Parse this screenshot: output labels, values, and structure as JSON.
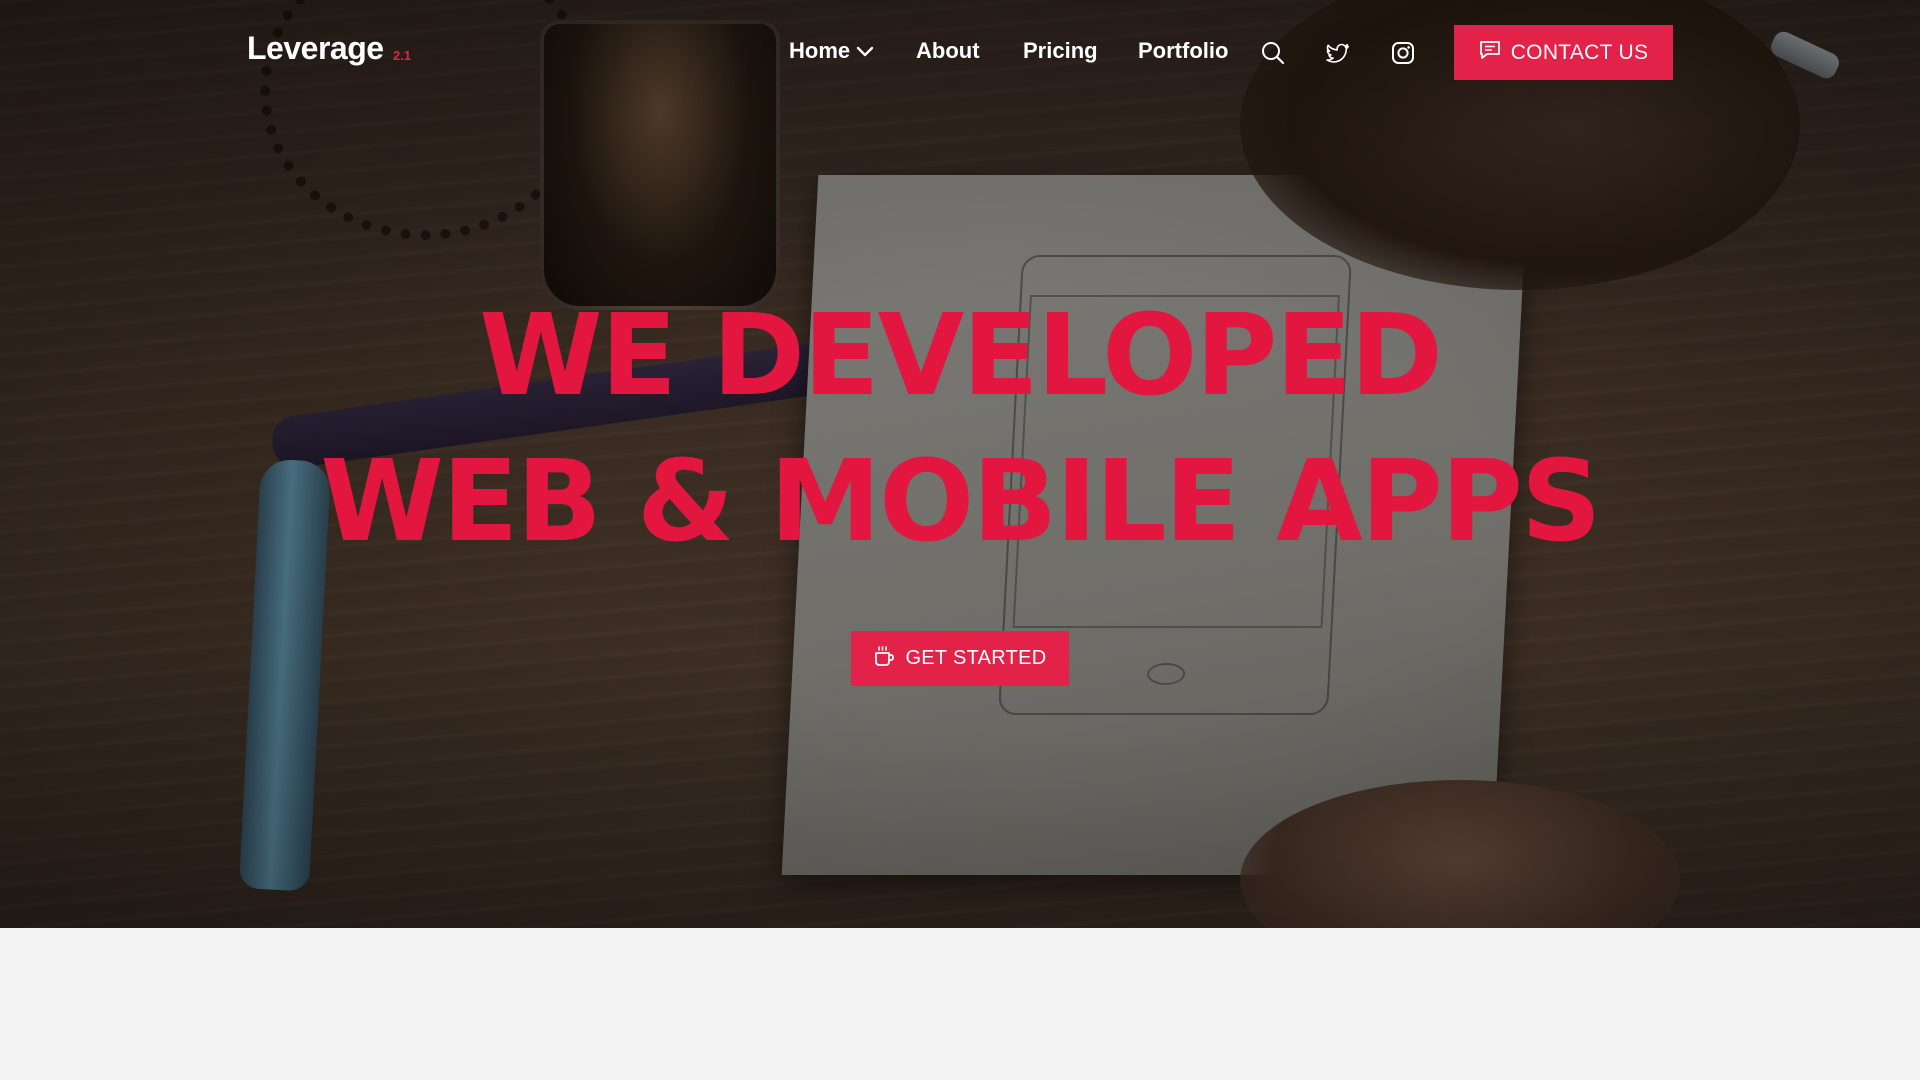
{
  "brand": {
    "name": "Leverage",
    "version": "2.1",
    "accent_color": "#e3224a",
    "headline_color": "#e3163f"
  },
  "nav": {
    "home": "Home",
    "about": "About",
    "pricing": "Pricing",
    "portfolio": "Portfolio",
    "icons": [
      "chevron-down-icon",
      "search-icon",
      "twitter-icon",
      "instagram-icon"
    ]
  },
  "header": {
    "contact_label": "CONTACT US"
  },
  "hero": {
    "line1": "WE DEVELOPED",
    "line2": "WEB & MOBILE APPS",
    "cta_label": "GET STARTED"
  }
}
